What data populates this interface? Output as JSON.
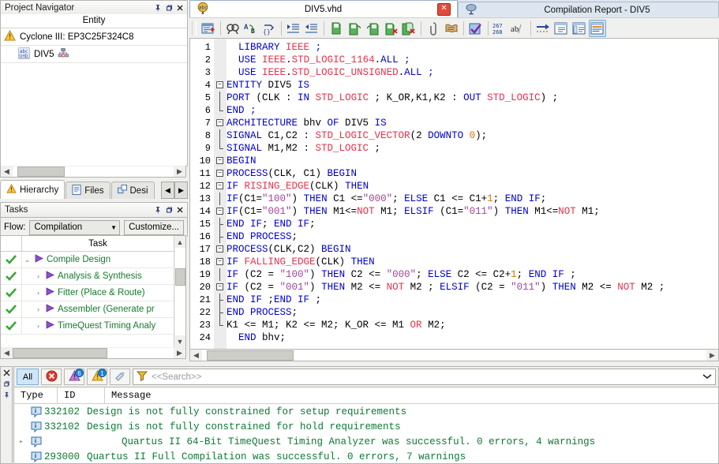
{
  "project_navigator": {
    "title": "Project Navigator",
    "column_header": "Entity",
    "rows": [
      {
        "icon": "warning-triangle-icon",
        "label": "Cyclone III: EP3C25F324C8",
        "indent": false
      },
      {
        "icon": "vhdl-file-icon",
        "label": "DIV5",
        "indent": true,
        "badge_icon": "hierarchy-icon"
      }
    ],
    "controls": {
      "pin": "pin-icon",
      "restore": "restore-icon",
      "close": "close-icon"
    }
  },
  "nav_tabs": {
    "items": [
      {
        "label": "Hierarchy",
        "icon": "warning-triangle-icon",
        "active": true
      },
      {
        "label": "Files",
        "icon": "file-icon",
        "active": false
      },
      {
        "label": "Desi",
        "icon": "design-units-icon",
        "active": false
      }
    ],
    "scroll_left": "◀",
    "scroll_right": "▶"
  },
  "tasks": {
    "title": "Tasks",
    "flow_label": "Flow:",
    "flow_value": "Compilation",
    "customize_label": "Customize...",
    "column_check": "",
    "column_task": "Task",
    "rows": [
      {
        "status": "check",
        "expander": "⌄",
        "label": "Compile Design",
        "indent": 0
      },
      {
        "status": "check",
        "expander": "›",
        "label": "Analysis & Synthesis",
        "indent": 1
      },
      {
        "status": "check",
        "expander": "›",
        "label": "Fitter (Place & Route)",
        "indent": 1
      },
      {
        "status": "check",
        "expander": "›",
        "label": "Assembler (Generate pr",
        "indent": 1
      },
      {
        "status": "check",
        "expander": "›",
        "label": "TimeQuest Timing Analy",
        "indent": 1
      }
    ]
  },
  "editor": {
    "tabs": [
      {
        "label": "DIV5.vhd",
        "icon": "vhdl-abc-icon",
        "active": true,
        "closable": true
      },
      {
        "label": "Compilation Report - DIV5",
        "icon": "report-icon",
        "active": false,
        "closable": false
      }
    ],
    "toolbar": [
      {
        "name": "insert-template-icon",
        "selected": false
      },
      {
        "name": "find-icon",
        "selected": false
      },
      {
        "name": "replace-icon",
        "selected": false
      },
      {
        "name": "goto-icon",
        "selected": false
      },
      {
        "name": "increase-indent-icon",
        "selected": false
      },
      {
        "name": "decrease-indent-icon",
        "selected": false
      },
      {
        "name": "comment-icon",
        "selected": false
      },
      {
        "name": "uncomment-icon",
        "selected": false
      },
      {
        "name": "undo-comment-icon",
        "selected": false
      },
      {
        "name": "remove-comment-icon",
        "selected": false
      },
      {
        "name": "remove-all-comments-icon",
        "selected": false
      },
      {
        "name": "bookmark-icon",
        "selected": false
      },
      {
        "name": "parse-icon",
        "selected": false
      },
      {
        "name": "check-syntax-icon",
        "selected": false
      },
      {
        "name": "line-numbers-icon",
        "label": "267\n268",
        "selected": false
      },
      {
        "name": "word-wrap-icon",
        "label": "ab/",
        "selected": false
      },
      {
        "name": "run-analysis-icon",
        "selected": false
      },
      {
        "name": "show-panel-left-icon",
        "selected": false
      },
      {
        "name": "show-panel-right-icon",
        "selected": false
      },
      {
        "name": "show-panel-bottom-icon",
        "selected": true
      }
    ],
    "lines": [
      {
        "n": 1,
        "fold": null,
        "tokens": [
          {
            "t": "  ",
            "c": "id"
          },
          {
            "t": "LIBRARY",
            "c": "kw"
          },
          {
            "t": " ",
            "c": "id"
          },
          {
            "t": "IEEE",
            "c": "ty"
          },
          {
            "t": " ;",
            "c": "kw"
          }
        ]
      },
      {
        "n": 2,
        "fold": null,
        "tokens": [
          {
            "t": "  ",
            "c": "id"
          },
          {
            "t": "USE",
            "c": "kw"
          },
          {
            "t": " ",
            "c": "id"
          },
          {
            "t": "IEEE",
            "c": "ty"
          },
          {
            "t": ".",
            "c": "id"
          },
          {
            "t": "STD_LOGIC_1164",
            "c": "ty"
          },
          {
            "t": ".",
            "c": "id"
          },
          {
            "t": "ALL",
            "c": "kw"
          },
          {
            "t": " ;",
            "c": "kw"
          }
        ]
      },
      {
        "n": 3,
        "fold": null,
        "tokens": [
          {
            "t": "  ",
            "c": "id"
          },
          {
            "t": "USE",
            "c": "kw"
          },
          {
            "t": " ",
            "c": "id"
          },
          {
            "t": "IEEE",
            "c": "ty"
          },
          {
            "t": ".",
            "c": "id"
          },
          {
            "t": "STD_LOGIC_UNSIGNED",
            "c": "ty"
          },
          {
            "t": ".",
            "c": "id"
          },
          {
            "t": "ALL",
            "c": "kw"
          },
          {
            "t": " ;",
            "c": "kw"
          }
        ]
      },
      {
        "n": 4,
        "fold": "open",
        "tokens": [
          {
            "t": "ENTITY",
            "c": "kw"
          },
          {
            "t": " DIV5 ",
            "c": "id"
          },
          {
            "t": "IS",
            "c": "kw"
          }
        ]
      },
      {
        "n": 5,
        "fold": "bar",
        "tokens": [
          {
            "t": "PORT",
            "c": "kw"
          },
          {
            "t": " (CLK : ",
            "c": "id"
          },
          {
            "t": "IN",
            "c": "kw"
          },
          {
            "t": " ",
            "c": "id"
          },
          {
            "t": "STD_LOGIC",
            "c": "ty"
          },
          {
            "t": " ; K_OR,K1,K2 : ",
            "c": "id"
          },
          {
            "t": "OUT",
            "c": "kw"
          },
          {
            "t": " ",
            "c": "id"
          },
          {
            "t": "STD_LOGIC",
            "c": "ty"
          },
          {
            "t": ") ;",
            "c": "id"
          }
        ]
      },
      {
        "n": 6,
        "fold": "end",
        "tokens": [
          {
            "t": "END",
            "c": "kw"
          },
          {
            "t": " ;",
            "c": "kw"
          }
        ]
      },
      {
        "n": 7,
        "fold": "open",
        "tokens": [
          {
            "t": "ARCHITECTURE",
            "c": "kw"
          },
          {
            "t": " bhv ",
            "c": "id"
          },
          {
            "t": "OF",
            "c": "kw"
          },
          {
            "t": " DIV5 ",
            "c": "id"
          },
          {
            "t": "IS",
            "c": "kw"
          }
        ]
      },
      {
        "n": 8,
        "fold": "bar",
        "tokens": [
          {
            "t": "SIGNAL",
            "c": "kw"
          },
          {
            "t": " C1,C2 : ",
            "c": "id"
          },
          {
            "t": "STD_LOGIC_VECTOR",
            "c": "ty"
          },
          {
            "t": "(2 ",
            "c": "id"
          },
          {
            "t": "DOWNTO",
            "c": "kw"
          },
          {
            "t": " ",
            "c": "id"
          },
          {
            "t": "0",
            "c": "nu"
          },
          {
            "t": ");",
            "c": "id"
          }
        ]
      },
      {
        "n": 9,
        "fold": "end",
        "tokens": [
          {
            "t": "SIGNAL",
            "c": "kw"
          },
          {
            "t": " M1,M2 : ",
            "c": "id"
          },
          {
            "t": "STD_LOGIC",
            "c": "ty"
          },
          {
            "t": " ;",
            "c": "id"
          }
        ]
      },
      {
        "n": 10,
        "fold": "open",
        "tokens": [
          {
            "t": "BEGIN",
            "c": "kw"
          }
        ]
      },
      {
        "n": 11,
        "fold": "open",
        "tokens": [
          {
            "t": "PROCESS",
            "c": "kw"
          },
          {
            "t": "(CLK, C1) ",
            "c": "id"
          },
          {
            "t": "BEGIN",
            "c": "kw"
          }
        ]
      },
      {
        "n": 12,
        "fold": "open",
        "tokens": [
          {
            "t": "IF",
            "c": "kw"
          },
          {
            "t": " ",
            "c": "id"
          },
          {
            "t": "RISING_EDGE",
            "c": "ty"
          },
          {
            "t": "(CLK) ",
            "c": "id"
          },
          {
            "t": "THEN",
            "c": "kw"
          }
        ]
      },
      {
        "n": 13,
        "fold": "bar",
        "tokens": [
          {
            "t": "IF",
            "c": "kw"
          },
          {
            "t": "(C1=",
            "c": "id"
          },
          {
            "t": "\"100\"",
            "c": "st"
          },
          {
            "t": ") ",
            "c": "id"
          },
          {
            "t": "THEN",
            "c": "kw"
          },
          {
            "t": " C1 <=",
            "c": "id"
          },
          {
            "t": "\"000\"",
            "c": "st"
          },
          {
            "t": "; ",
            "c": "id"
          },
          {
            "t": "ELSE",
            "c": "kw"
          },
          {
            "t": " C1 <= C1+",
            "c": "id"
          },
          {
            "t": "1",
            "c": "nu"
          },
          {
            "t": "; ",
            "c": "id"
          },
          {
            "t": "END IF",
            "c": "kw"
          },
          {
            "t": ";",
            "c": "id"
          }
        ]
      },
      {
        "n": 14,
        "fold": "open",
        "tokens": [
          {
            "t": "IF",
            "c": "kw"
          },
          {
            "t": "(C1=",
            "c": "id"
          },
          {
            "t": "\"001\"",
            "c": "st"
          },
          {
            "t": ") ",
            "c": "id"
          },
          {
            "t": "THEN",
            "c": "kw"
          },
          {
            "t": " M1<=",
            "c": "id"
          },
          {
            "t": "NOT",
            "c": "ty"
          },
          {
            "t": " M1; ",
            "c": "id"
          },
          {
            "t": "ELSIF",
            "c": "kw"
          },
          {
            "t": " (C1=",
            "c": "id"
          },
          {
            "t": "\"011\"",
            "c": "st"
          },
          {
            "t": ") ",
            "c": "id"
          },
          {
            "t": "THEN",
            "c": "kw"
          },
          {
            "t": " M1<=",
            "c": "id"
          },
          {
            "t": "NOT",
            "c": "ty"
          },
          {
            "t": " M1;",
            "c": "id"
          }
        ]
      },
      {
        "n": 15,
        "fold": "tick",
        "tokens": [
          {
            "t": "END IF",
            "c": "kw"
          },
          {
            "t": "; ",
            "c": "id"
          },
          {
            "t": "END IF",
            "c": "kw"
          },
          {
            "t": ";",
            "c": "id"
          }
        ]
      },
      {
        "n": 16,
        "fold": "tick",
        "tokens": [
          {
            "t": "END PROCESS",
            "c": "kw"
          },
          {
            "t": ";",
            "c": "id"
          }
        ]
      },
      {
        "n": 17,
        "fold": "open",
        "tokens": [
          {
            "t": "PROCESS",
            "c": "kw"
          },
          {
            "t": "(CLK,C2) ",
            "c": "id"
          },
          {
            "t": "BEGIN",
            "c": "kw"
          }
        ]
      },
      {
        "n": 18,
        "fold": "open",
        "tokens": [
          {
            "t": "IF",
            "c": "kw"
          },
          {
            "t": " ",
            "c": "id"
          },
          {
            "t": "FALLING_EDGE",
            "c": "ty"
          },
          {
            "t": "(CLK) ",
            "c": "id"
          },
          {
            "t": "THEN",
            "c": "kw"
          }
        ]
      },
      {
        "n": 19,
        "fold": "bar",
        "tokens": [
          {
            "t": "IF",
            "c": "kw"
          },
          {
            "t": " (C2 = ",
            "c": "id"
          },
          {
            "t": "\"100\"",
            "c": "st"
          },
          {
            "t": ") ",
            "c": "id"
          },
          {
            "t": "THEN",
            "c": "kw"
          },
          {
            "t": " C2 <= ",
            "c": "id"
          },
          {
            "t": "\"000\"",
            "c": "st"
          },
          {
            "t": "; ",
            "c": "id"
          },
          {
            "t": "ELSE",
            "c": "kw"
          },
          {
            "t": " C2 <= C2+",
            "c": "id"
          },
          {
            "t": "1",
            "c": "nu"
          },
          {
            "t": "; ",
            "c": "id"
          },
          {
            "t": "END IF",
            "c": "kw"
          },
          {
            "t": " ;",
            "c": "id"
          }
        ]
      },
      {
        "n": 20,
        "fold": "open",
        "tokens": [
          {
            "t": "IF",
            "c": "kw"
          },
          {
            "t": " (C2 = ",
            "c": "id"
          },
          {
            "t": "\"001\"",
            "c": "st"
          },
          {
            "t": ") ",
            "c": "id"
          },
          {
            "t": "THEN",
            "c": "kw"
          },
          {
            "t": " M2 <= ",
            "c": "id"
          },
          {
            "t": "NOT",
            "c": "ty"
          },
          {
            "t": " M2 ; ",
            "c": "id"
          },
          {
            "t": "ELSIF",
            "c": "kw"
          },
          {
            "t": " (C2 = ",
            "c": "id"
          },
          {
            "t": "\"011\"",
            "c": "st"
          },
          {
            "t": ") ",
            "c": "id"
          },
          {
            "t": "THEN",
            "c": "kw"
          },
          {
            "t": " M2 <= ",
            "c": "id"
          },
          {
            "t": "NOT",
            "c": "ty"
          },
          {
            "t": " M2 ;",
            "c": "id"
          }
        ]
      },
      {
        "n": 21,
        "fold": "tick",
        "tokens": [
          {
            "t": "END IF",
            "c": "kw"
          },
          {
            "t": " ;",
            "c": "id"
          },
          {
            "t": "END IF",
            "c": "kw"
          },
          {
            "t": " ;",
            "c": "id"
          }
        ]
      },
      {
        "n": 22,
        "fold": "tick",
        "tokens": [
          {
            "t": "END PROCESS",
            "c": "kw"
          },
          {
            "t": ";",
            "c": "id"
          }
        ]
      },
      {
        "n": 23,
        "fold": "end",
        "tokens": [
          {
            "t": "K1 <= M1; K2 <= M2; K_OR <= M1 ",
            "c": "id"
          },
          {
            "t": "OR",
            "c": "ty"
          },
          {
            "t": " M2;",
            "c": "id"
          }
        ]
      },
      {
        "n": 24,
        "fold": null,
        "tokens": [
          {
            "t": "  ",
            "c": "id"
          },
          {
            "t": "END",
            "c": "kw"
          },
          {
            "t": " bhv;",
            "c": "id"
          }
        ]
      }
    ]
  },
  "messages": {
    "filter_all_label": "All",
    "filter_buttons": [
      {
        "name": "error-filter-icon",
        "badge": null
      },
      {
        "name": "critical-warning-filter-icon",
        "badge": "6"
      },
      {
        "name": "warning-filter-icon",
        "badge": "1"
      },
      {
        "name": "info-filter-icon",
        "badge": null
      }
    ],
    "search_placeholder": "<<Search>>",
    "columns": {
      "type": "Type",
      "id": "ID",
      "message": "Message"
    },
    "rows": [
      {
        "icon": "info-icon",
        "expandable": false,
        "id": "332102",
        "text": "Design is not fully constrained for setup requirements"
      },
      {
        "icon": "info-icon",
        "expandable": false,
        "id": "332102",
        "text": "Design is not fully constrained for hold requirements"
      },
      {
        "icon": "info-icon",
        "expandable": true,
        "id": "",
        "text": "Quartus II 64-Bit TimeQuest Timing Analyzer was successful. 0 errors, 4 warnings"
      },
      {
        "icon": "info-icon",
        "expandable": false,
        "id": "293000",
        "text": "Quartus II Full Compilation was successful. 0 errors, 7 warnings"
      }
    ],
    "left_strip": {
      "close": "close-icon",
      "restore": "restore-icon",
      "pin": "pin-icon"
    }
  },
  "colors": {
    "keyword": "#0000d0",
    "type": "#e8304a",
    "string": "#a0449a",
    "number": "#e07000",
    "message_text": "#0b7a33",
    "task_text": "#157a2e",
    "accent_selected": "#cfe4f7"
  }
}
